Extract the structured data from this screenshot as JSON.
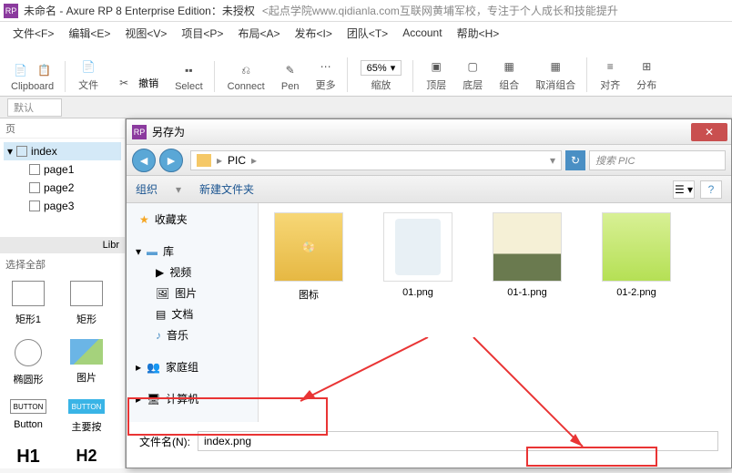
{
  "title": {
    "main": "未命名 - Axure RP 8 Enterprise Edition：未授权",
    "sub": "<起点学院www.qidianla.com互联网黄埔军校，专注于个人成长和技能提升"
  },
  "menus": [
    "文件<F>",
    "编辑<E>",
    "视图<V>",
    "项目<P>",
    "布局<A>",
    "发布<I>",
    "团队<T>",
    "Account",
    "帮助<H>"
  ],
  "toolbar": {
    "file": "文件",
    "clipboard": "Clipboard",
    "undo_text": "撤销",
    "select": "Select",
    "connect": "Connect",
    "pen": "Pen",
    "more": "更多",
    "zoom": "65%",
    "zoom_label": "缩放",
    "top": "顶层",
    "bottom": "底层",
    "group": "组合",
    "ungroup": "取消组合",
    "align": "对齐",
    "distribute": "分布"
  },
  "subbar": {
    "default": "默认"
  },
  "sidebar": {
    "pages_root": "index",
    "pages": [
      "page1",
      "page2",
      "page3"
    ],
    "lib_label": "Libr",
    "select_all": "选择全部",
    "shape_rect": "矩形1",
    "shape_rect2": "矩形",
    "shape_circle": "椭圆形",
    "shape_img": "图片",
    "shape_button": "Button",
    "shape_primary": "主要按",
    "h1": "H1",
    "h2": "H2",
    "button_text": "BUTTON"
  },
  "dialog": {
    "title": "另存为",
    "breadcrumb_item": "PIC",
    "search_placeholder": "搜索 PIC",
    "organize": "组织",
    "newfolder": "新建文件夹",
    "sidebar": {
      "favorites": "收藏夹",
      "library": "库",
      "video": "视频",
      "pictures": "图片",
      "documents": "文档",
      "music": "音乐",
      "homegroup": "家庭组",
      "computer": "计算机"
    },
    "files": [
      "图标",
      "01.png",
      "01-1.png",
      "01-2.png"
    ],
    "filename_label": "文件名(N):",
    "filename_value": "index.png"
  }
}
